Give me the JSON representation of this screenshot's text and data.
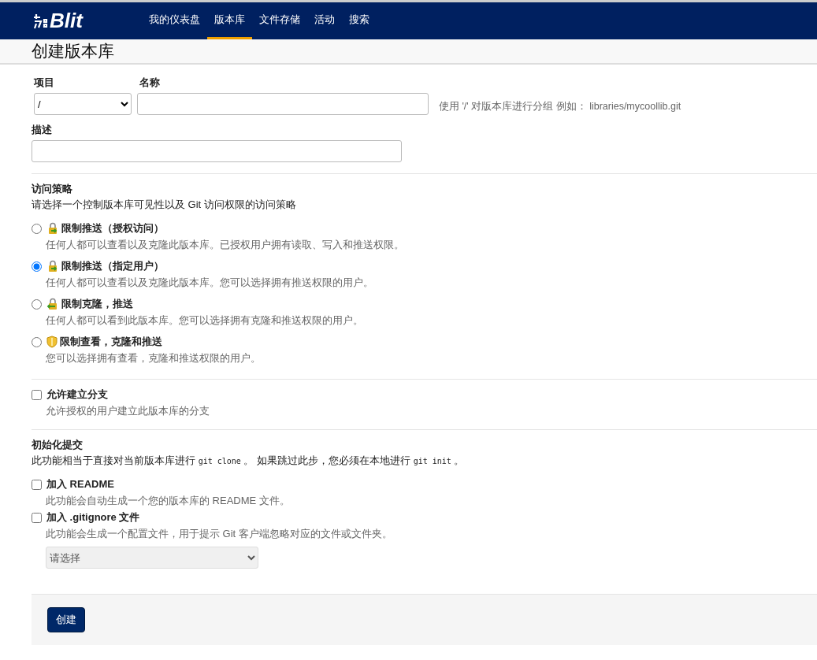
{
  "brand": {
    "logo_text": "Blit"
  },
  "nav": [
    {
      "label": "我的仪表盘",
      "selected": false
    },
    {
      "label": "版本库",
      "selected": true
    },
    {
      "label": "文件存储",
      "selected": false
    },
    {
      "label": "活动",
      "selected": false
    },
    {
      "label": "搜索",
      "selected": false
    }
  ],
  "page_title": "创建版本库",
  "form": {
    "project_label": "项目",
    "project_value": "/",
    "name_label": "名称",
    "name_hint": "使用 '/' 对版本库进行分组 例如： libraries/mycoollib.git",
    "description_label": "描述"
  },
  "access": {
    "title": "访问策略",
    "subtitle": "请选择一个控制版本库可见性以及 Git 访问权限的访问策略",
    "options": [
      {
        "kind": "lock-push",
        "label": "限制推送（授权访问）",
        "description": "任何人都可以查看以及克隆此版本库。已授权用户拥有读取、写入和推送权限。",
        "selected": false
      },
      {
        "kind": "lock-push",
        "label": "限制推送（指定用户）",
        "description": "任何人都可以查看以及克隆此版本库。您可以选择拥有推送权限的用户。",
        "selected": true
      },
      {
        "kind": "lock-clone",
        "label": "限制克隆，推送",
        "description": "任何人都可以看到此版本库。您可以选择拥有克隆和推送权限的用户。",
        "selected": false
      },
      {
        "kind": "shield",
        "label": "限制查看，克隆和推送",
        "description": "您可以选择拥有查看，克隆和推送权限的用户。",
        "selected": false
      }
    ]
  },
  "fork": {
    "label": "允许建立分支",
    "description": "允许授权的用户建立此版本库的分支",
    "checked": false
  },
  "init": {
    "title": "初始化提交",
    "note": [
      {
        "kind": "text",
        "text": "此功能相当于直接对当前版本库进行 "
      },
      {
        "kind": "code",
        "text": "git clone"
      },
      {
        "kind": "text",
        "text": " 。 如果跳过此步，您必须在本地进行 "
      },
      {
        "kind": "code",
        "text": "git init"
      },
      {
        "kind": "text",
        "text": " 。"
      }
    ],
    "options": [
      {
        "label": "加入 README",
        "description": "此功能会自动生成一个您的版本库的 README 文件。",
        "checked": false
      },
      {
        "label": "加入 .gitignore 文件",
        "description": "此功能会生成一个配置文件，用于提示 Git 客户端忽略对应的文件或文件夹。",
        "checked": false
      }
    ],
    "gitignore_select": "请选择"
  },
  "submit": "创建"
}
